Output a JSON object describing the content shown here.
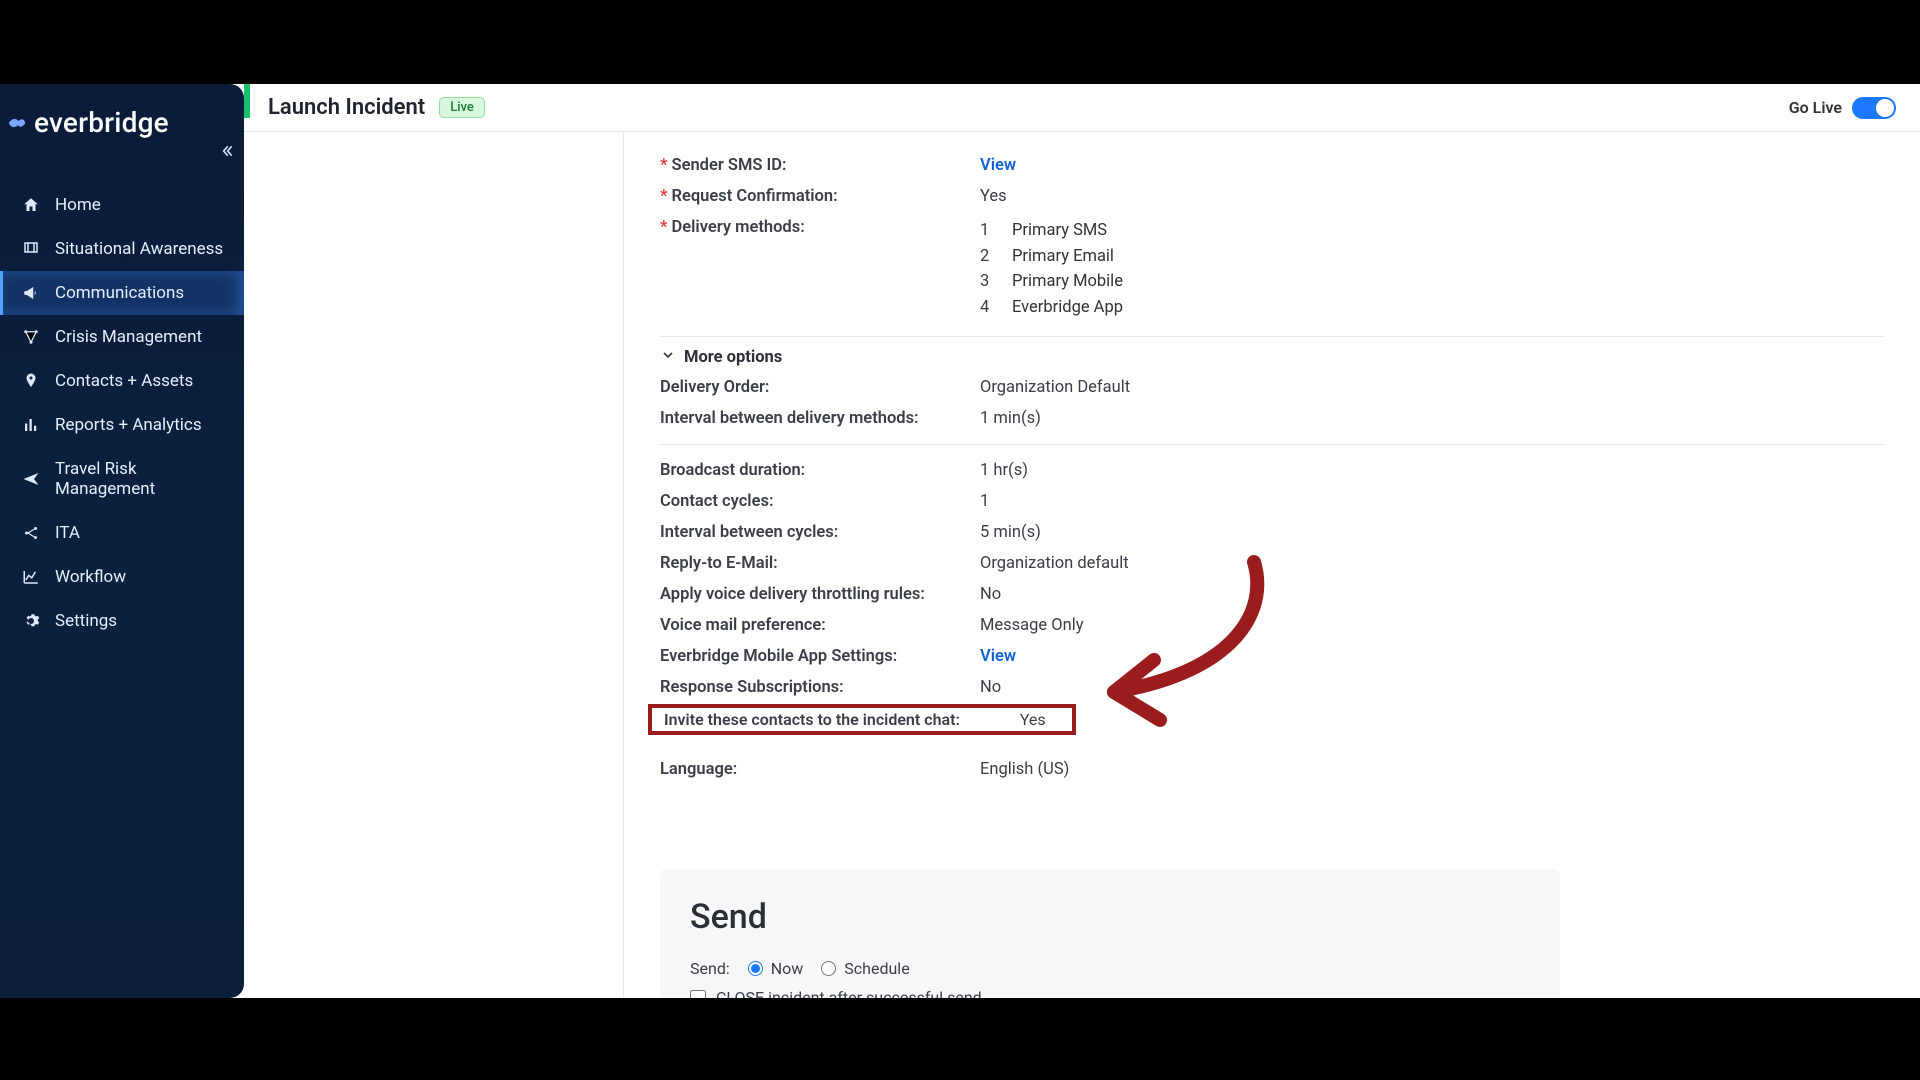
{
  "brand": "everbridge",
  "header": {
    "title": "Launch Incident",
    "live_badge": "Live",
    "go_live_label": "Go Live",
    "go_live_on": true
  },
  "sidebar": {
    "items": [
      {
        "id": "home",
        "label": "Home"
      },
      {
        "id": "situational-awareness",
        "label": "Situational Awareness"
      },
      {
        "id": "communications",
        "label": "Communications",
        "active": true
      },
      {
        "id": "crisis-management",
        "label": "Crisis Management"
      },
      {
        "id": "contacts-assets",
        "label": "Contacts + Assets"
      },
      {
        "id": "reports-analytics",
        "label": "Reports + Analytics"
      },
      {
        "id": "travel-risk",
        "label": "Travel Risk Management"
      },
      {
        "id": "ita",
        "label": "ITA"
      },
      {
        "id": "workflow",
        "label": "Workflow"
      },
      {
        "id": "settings",
        "label": "Settings"
      }
    ]
  },
  "settings": {
    "sender_sms_id": {
      "label": "Sender SMS ID:",
      "action": "View",
      "required": true
    },
    "request_confirmation": {
      "label": "Request Confirmation:",
      "value": "Yes",
      "required": true
    },
    "delivery_methods": {
      "label": "Delivery methods:",
      "required": true,
      "list": [
        {
          "n": "1",
          "name": "Primary SMS"
        },
        {
          "n": "2",
          "name": "Primary Email"
        },
        {
          "n": "3",
          "name": "Primary Mobile"
        },
        {
          "n": "4",
          "name": "Everbridge App"
        }
      ]
    },
    "more_options_label": "More options",
    "delivery_order": {
      "label": "Delivery Order:",
      "value": "Organization Default"
    },
    "interval_between_methods": {
      "label": "Interval between delivery methods:",
      "value": "1 min(s)"
    },
    "broadcast_duration": {
      "label": "Broadcast duration:",
      "value": "1 hr(s)"
    },
    "contact_cycles": {
      "label": "Contact cycles:",
      "value": "1"
    },
    "interval_between_cycles": {
      "label": "Interval between cycles:",
      "value": "5 min(s)"
    },
    "reply_to_email": {
      "label": "Reply-to E-Mail:",
      "value": "Organization default"
    },
    "throttling": {
      "label": "Apply voice delivery throttling rules:",
      "value": "No"
    },
    "voicemail_pref": {
      "label": "Voice mail preference:",
      "value": "Message Only"
    },
    "mobile_app_settings": {
      "label": "Everbridge Mobile App Settings:",
      "action": "View"
    },
    "response_subscriptions": {
      "label": "Response Subscriptions:",
      "value": "No"
    },
    "invite_chat": {
      "label": "Invite these contacts to the incident chat:",
      "value": "Yes"
    },
    "language": {
      "label": "Language:",
      "value": "English (US)"
    }
  },
  "send": {
    "title": "Send",
    "send_label": "Send:",
    "now_label": "Now",
    "schedule_label": "Schedule",
    "close_checkbox_label": "CLOSE incident after successful send"
  }
}
